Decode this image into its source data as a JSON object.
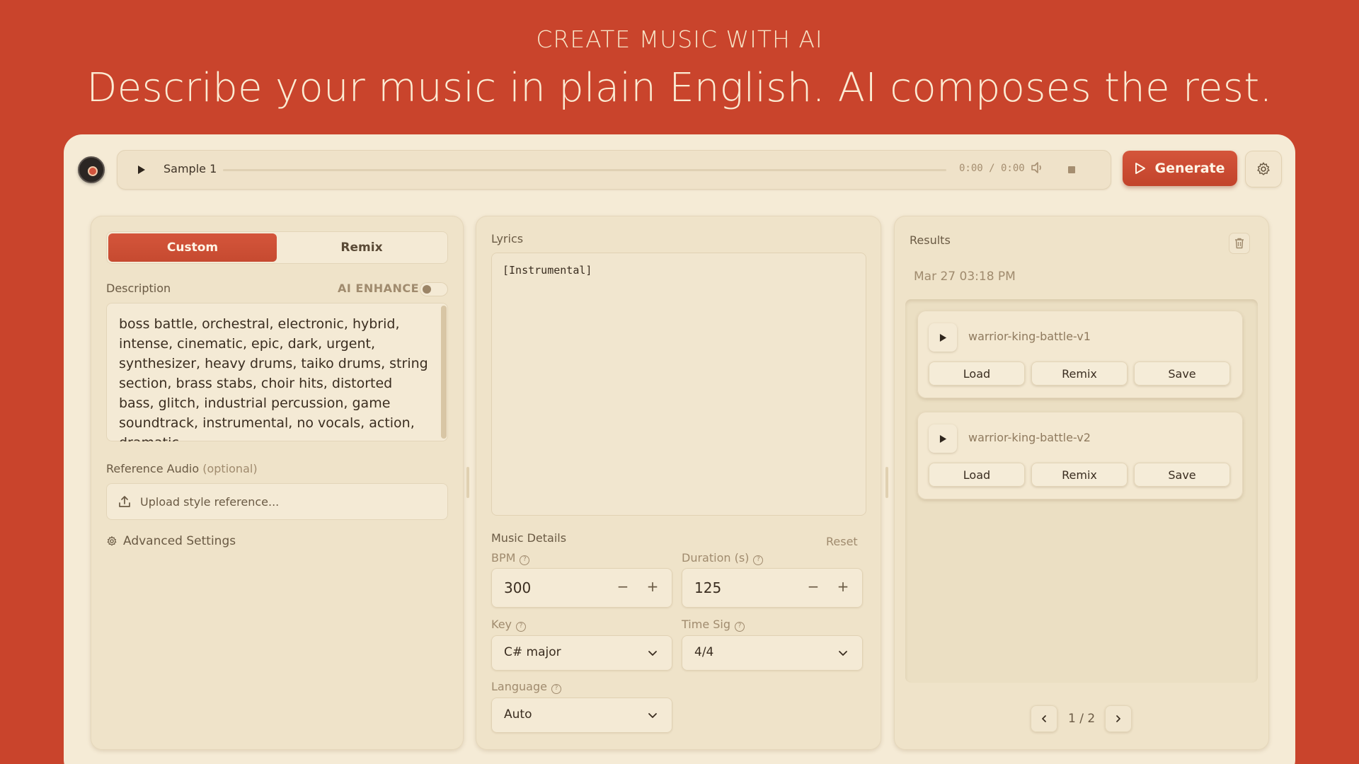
{
  "hero": {
    "eyebrow": "CREATE MUSIC WITH AI",
    "title": "Describe your music in plain English. AI composes the rest."
  },
  "player": {
    "track_title": "Sample 1",
    "time": "0:00 / 0:00",
    "progress": 0
  },
  "toolbar": {
    "generate_label": "Generate"
  },
  "left_panel": {
    "tabs": [
      {
        "label": "Custom",
        "active": true
      },
      {
        "label": "Remix",
        "active": false
      }
    ],
    "description_label": "Description",
    "ai_enhance_label": "AI ENHANCE",
    "ai_enhance_on": false,
    "description_text": "boss battle, orchestral, electronic, hybrid, intense, cinematic, epic, dark, urgent, synthesizer, heavy drums, taiko drums, string section, brass stabs, choir hits, distorted bass, glitch, industrial percussion, game soundtrack, instrumental, no vocals, action, dramatic",
    "reference_label": "Reference Audio",
    "reference_optional": "(optional)",
    "upload_placeholder": "Upload style reference...",
    "advanced_label": "Advanced Settings"
  },
  "mid_panel": {
    "lyrics_label": "Lyrics",
    "lyrics_text": "[Instrumental]",
    "music_details_label": "Music Details",
    "reset_label": "Reset",
    "bpm_label": "BPM",
    "bpm_value": "300",
    "duration_label": "Duration (s)",
    "duration_value": "125",
    "key_label": "Key",
    "key_value": "C# major",
    "timesig_label": "Time Sig",
    "timesig_value": "4/4",
    "language_label": "Language",
    "language_value": "Auto"
  },
  "right_panel": {
    "results_label": "Results",
    "timestamp": "Mar 27 03:18 PM",
    "results": [
      {
        "name": "warrior-king-battle-v1",
        "load": "Load",
        "remix": "Remix",
        "save": "Save"
      },
      {
        "name": "warrior-king-battle-v2",
        "load": "Load",
        "remix": "Remix",
        "save": "Save"
      }
    ],
    "page_indicator": "1 / 2"
  },
  "colors": {
    "background": "#c9442c",
    "card": "#f5ebd6",
    "accent": "#c9442c"
  }
}
